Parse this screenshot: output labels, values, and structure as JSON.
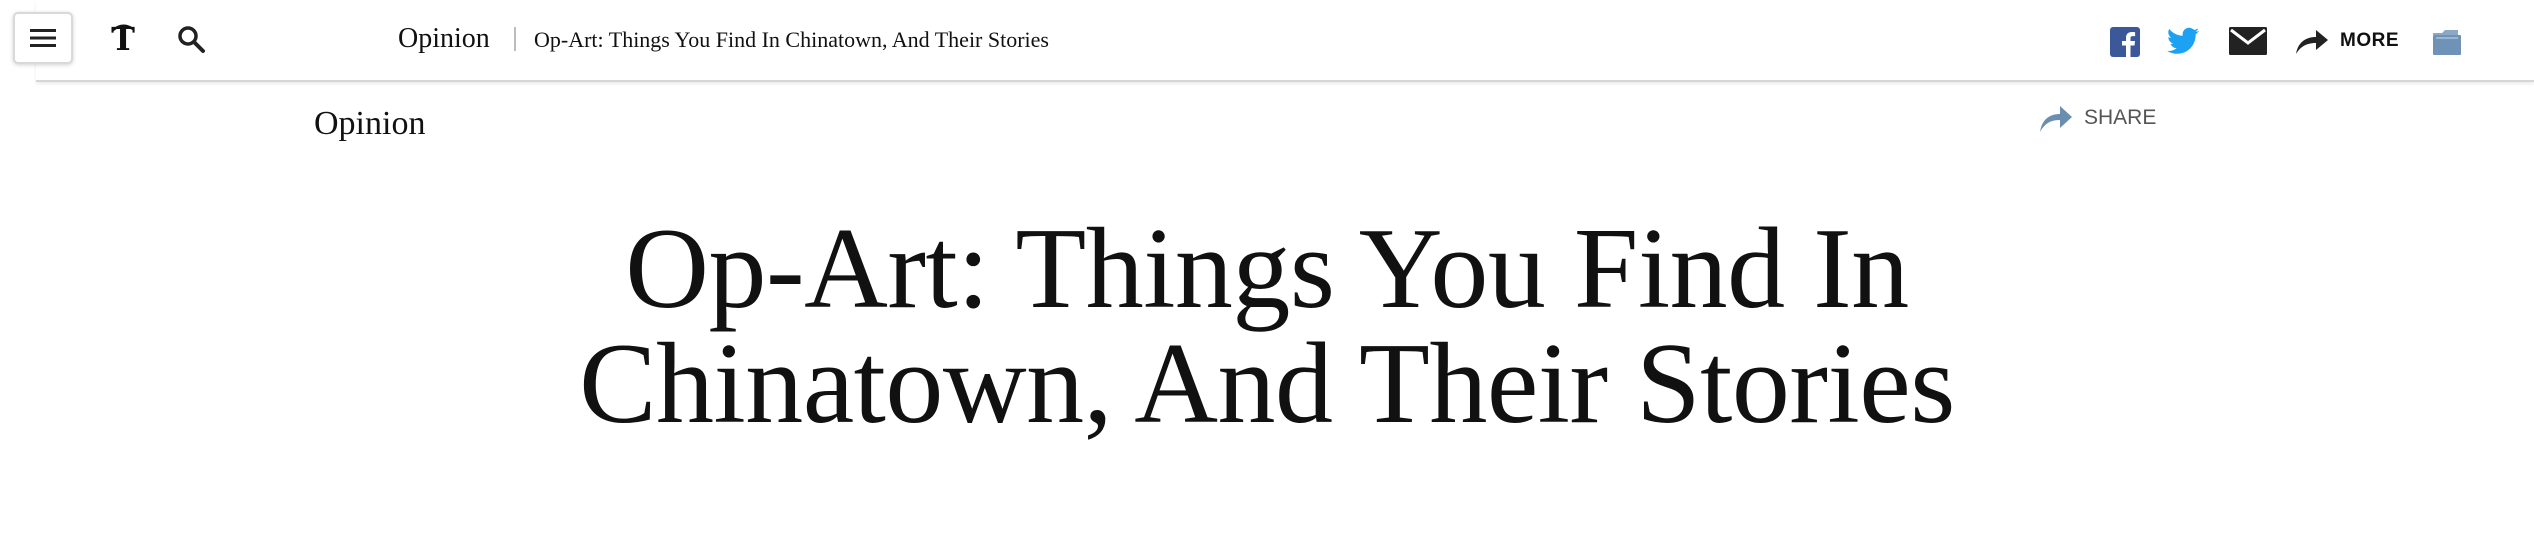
{
  "header": {
    "section": "Opinion",
    "title": "Op-Art: Things You Find In Chinatown, And Their Stories",
    "more_label": "MORE",
    "icons": {
      "menu": "hamburger-icon",
      "logo": "nyt-t-logo-icon",
      "search": "search-icon",
      "facebook": "facebook-icon",
      "twitter": "twitter-icon",
      "email": "email-icon",
      "more": "share-arrow-icon",
      "save": "folder-icon"
    }
  },
  "article": {
    "kicker": "Opinion",
    "share_label": "SHARE",
    "headline_line1": "Op-Art: Things You Find In",
    "headline_line2": "Chinatown, And Their Stories"
  },
  "colors": {
    "facebook": "#3b5998",
    "twitter": "#1da1f2",
    "folder": "#6f93b7",
    "share_arrow": "#6b8eb0",
    "divider": "#d6d6d6"
  }
}
